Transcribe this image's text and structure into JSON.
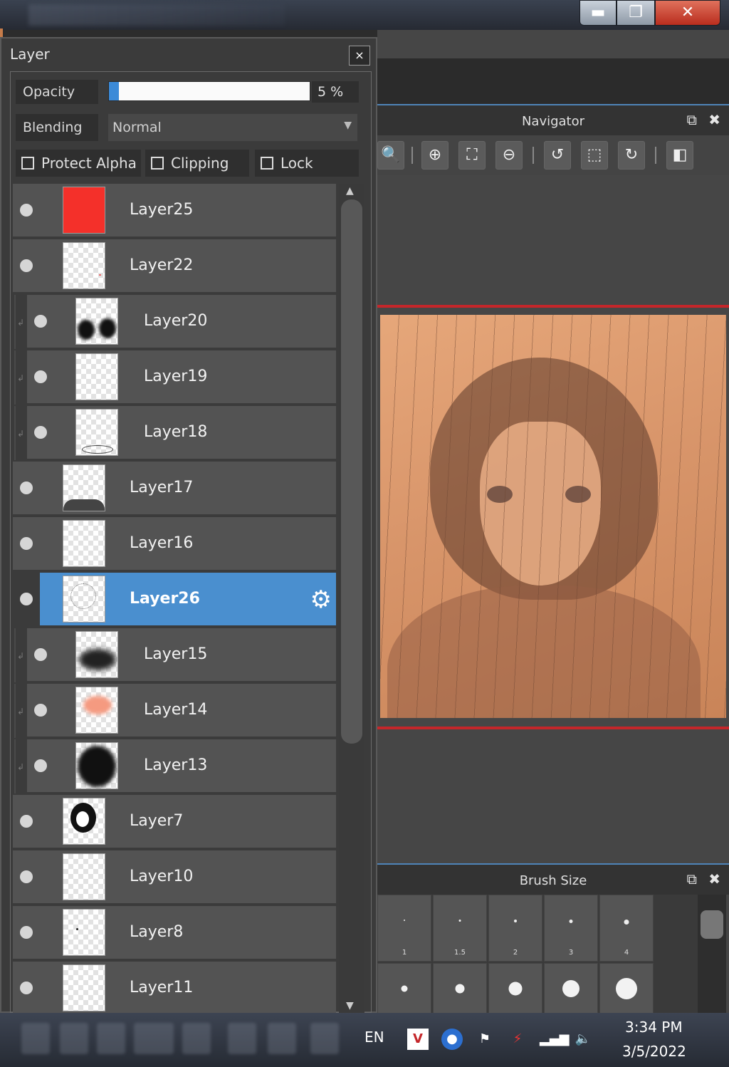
{
  "window_controls": {
    "minimize": "▬",
    "maximize": "❐",
    "close": "✕"
  },
  "layer_panel": {
    "title": "Layer",
    "close_label": "×",
    "opacity_label": "Opacity",
    "opacity_value": "5 %",
    "opacity_fraction": 0.05,
    "blending_label": "Blending",
    "blending_value": "Normal",
    "protect_alpha_label": "Protect Alpha",
    "clipping_label": "Clipping",
    "lock_label": "Lock",
    "layers": [
      {
        "name": "Layer25",
        "clip": false,
        "selected": false
      },
      {
        "name": "Layer22",
        "clip": false,
        "selected": false
      },
      {
        "name": "Layer20",
        "clip": true,
        "selected": false
      },
      {
        "name": "Layer19",
        "clip": true,
        "selected": false
      },
      {
        "name": "Layer18",
        "clip": true,
        "selected": false
      },
      {
        "name": "Layer17",
        "clip": false,
        "selected": false
      },
      {
        "name": "Layer16",
        "clip": false,
        "selected": false
      },
      {
        "name": "Layer26",
        "clip": false,
        "selected": true
      },
      {
        "name": "Layer15",
        "clip": true,
        "selected": false
      },
      {
        "name": "Layer14",
        "clip": true,
        "selected": false
      },
      {
        "name": "Layer13",
        "clip": true,
        "selected": false
      },
      {
        "name": "Layer7",
        "clip": false,
        "selected": false
      },
      {
        "name": "Layer10",
        "clip": false,
        "selected": false
      },
      {
        "name": "Layer8",
        "clip": false,
        "selected": false
      },
      {
        "name": "Layer11",
        "clip": false,
        "selected": false
      }
    ]
  },
  "navigator": {
    "title": "Navigator",
    "popout_icon": "⧉",
    "close_icon": "✖",
    "tools": [
      "🔍",
      "⊕",
      "⛶",
      "⊖",
      "↺",
      "⬚",
      "↻",
      "◧"
    ]
  },
  "brush_size": {
    "title": "Brush Size",
    "sizes": [
      "1",
      "1.5",
      "2",
      "3",
      "4"
    ]
  },
  "taskbar": {
    "language": "EN",
    "time": "3:34 PM",
    "date": "3/5/2022"
  },
  "colors": {
    "selection": "#4a8fcf",
    "accent_line": "#4e84b8",
    "red_marker": "#c4262a",
    "layer25_fill": "#f4302a"
  }
}
